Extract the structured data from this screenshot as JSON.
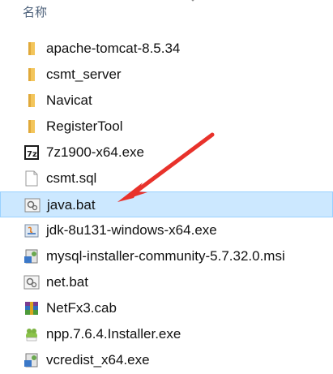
{
  "header": {
    "column_name": "名称"
  },
  "files": [
    {
      "name": "apache-tomcat-8.5.34",
      "icon": "folder-icon"
    },
    {
      "name": "csmt_server",
      "icon": "folder-icon"
    },
    {
      "name": "Navicat",
      "icon": "folder-icon"
    },
    {
      "name": "RegisterTool",
      "icon": "folder-icon"
    },
    {
      "name": "7z1900-x64.exe",
      "icon": "7zip-icon"
    },
    {
      "name": "csmt.sql",
      "icon": "file-icon"
    },
    {
      "name": "java.bat",
      "icon": "batch-file-icon",
      "selected": true
    },
    {
      "name": "jdk-8u131-windows-x64.exe",
      "icon": "java-installer-icon"
    },
    {
      "name": "mysql-installer-community-5.7.32.0.msi",
      "icon": "msi-installer-icon"
    },
    {
      "name": "net.bat",
      "icon": "batch-file-icon"
    },
    {
      "name": "NetFx3.cab",
      "icon": "archive-icon"
    },
    {
      "name": "npp.7.6.4.Installer.exe",
      "icon": "notepad-plus-plus-icon"
    },
    {
      "name": "vcredist_x64.exe",
      "icon": "installer-icon"
    }
  ],
  "colors": {
    "selection_bg": "#cce8ff",
    "selection_border": "#99d1ff",
    "arrow": "#e8322b",
    "folder": "#f3c55b"
  }
}
